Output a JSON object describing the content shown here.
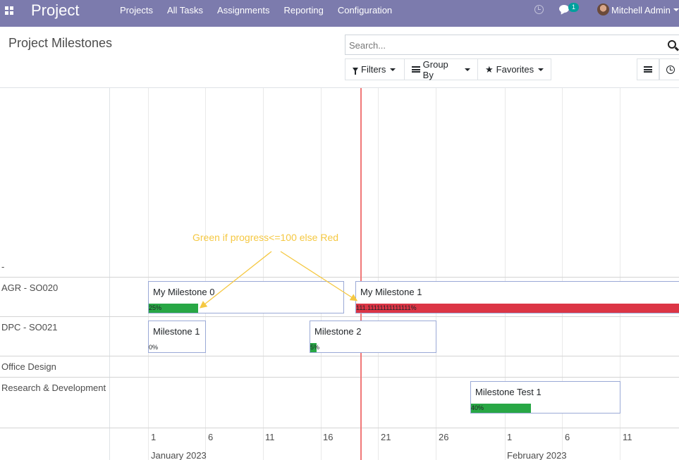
{
  "navbar": {
    "brand": "Project",
    "menu": [
      "Projects",
      "All Tasks",
      "Assignments",
      "Reporting",
      "Configuration"
    ],
    "chat_count": "1",
    "user_name": "Mitchell Admin",
    "color": "#7c7bad"
  },
  "control_panel": {
    "title": "Project Milestones",
    "search_placeholder": "Search...",
    "filters_label": "Filters",
    "group_by_label": "Group By",
    "favorites_label": "Favorites"
  },
  "gantt": {
    "rows": [
      {
        "label": "-"
      },
      {
        "label": "AGR - SO020"
      },
      {
        "label": "DPC - SO021"
      },
      {
        "label": "Office Design"
      },
      {
        "label": "Research & Development"
      }
    ],
    "milestones": [
      {
        "name": "My Milestone 0",
        "progress_label": "25%",
        "progress": 25,
        "status": "green"
      },
      {
        "name": "My Milestone 1",
        "progress_label": "111.11111111111111%",
        "progress": 111.11,
        "status": "red"
      },
      {
        "name": "Milestone 1",
        "progress_label": "0%",
        "progress": 0,
        "status": "green"
      },
      {
        "name": "Milestone 2",
        "progress_label": "5%",
        "progress": 5,
        "status": "green"
      },
      {
        "name": "Milestone Test 1",
        "progress_label": "40%",
        "progress": 40,
        "status": "green"
      }
    ],
    "days": [
      "1",
      "6",
      "11",
      "16",
      "21",
      "26",
      "1",
      "6",
      "11"
    ],
    "months": [
      "January 2023",
      "February 2023"
    ],
    "annotation": "Green if progress<=100 else Red",
    "colors": {
      "green": "#28a745",
      "red": "#dc3545",
      "today": "#f07878",
      "annotation": "#f5c842"
    }
  }
}
